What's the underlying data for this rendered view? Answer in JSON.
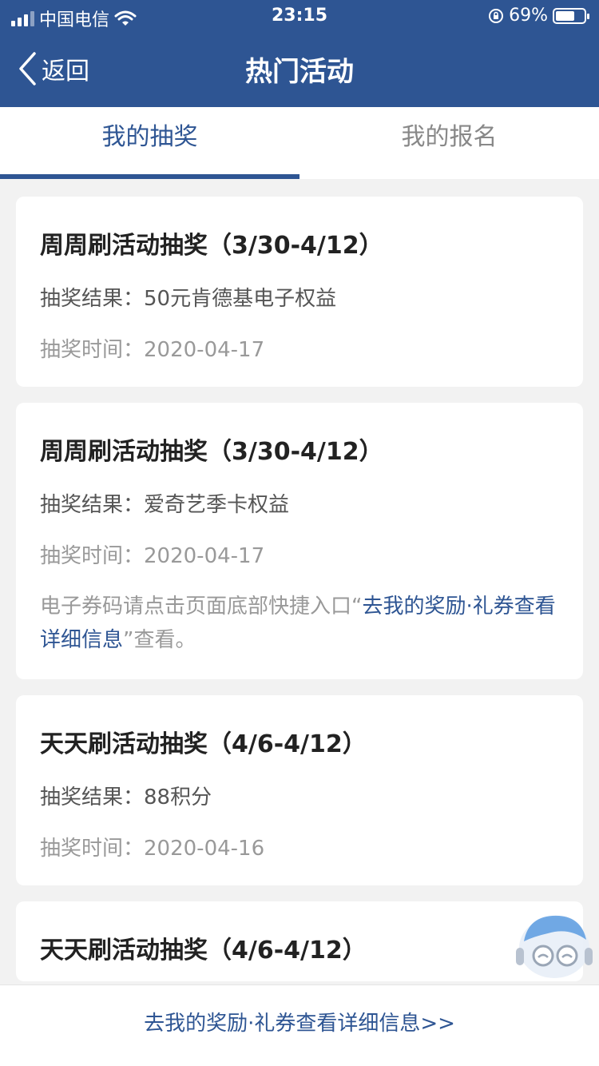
{
  "status_bar": {
    "carrier": "中国电信",
    "time": "23:15",
    "battery": "69%",
    "battery_level": 0.69,
    "icons": [
      "signal-icon",
      "wifi-icon",
      "rotation-lock-icon",
      "battery-icon"
    ]
  },
  "nav": {
    "back_label": "返回",
    "title": "热门活动"
  },
  "tabs": [
    {
      "label": "我的抽奖",
      "active": true
    },
    {
      "label": "我的报名",
      "active": false
    }
  ],
  "cards": [
    {
      "title": "周周刷活动抽奖（3/30-4/12）",
      "result_label": "抽奖结果：",
      "result_value": "50元肯德基电子权益",
      "date_label": "抽奖时间：",
      "date_value": "2020-04-17"
    },
    {
      "title": "周周刷活动抽奖（3/30-4/12）",
      "result_label": "抽奖结果：",
      "result_value": "爱奇艺季卡权益",
      "date_label": "抽奖时间：",
      "date_value": "2020-04-17",
      "note_prefix": "电子券码请点击页面底部快捷入口“",
      "note_link": "去我的奖励·礼券查看详细信息",
      "note_suffix": "”查看。"
    },
    {
      "title": "天天刷活动抽奖（4/6-4/12）",
      "result_label": "抽奖结果：",
      "result_value": "88积分",
      "date_label": "抽奖时间：",
      "date_value": "2020-04-16"
    },
    {
      "title": "天天刷活动抽奖（4/6-4/12）"
    }
  ],
  "bottom_link": "去我的奖励·礼券查看详细信息>>",
  "colors": {
    "brand": "#2e5593",
    "background": "#f2f2f2",
    "muted_text": "#999999"
  }
}
